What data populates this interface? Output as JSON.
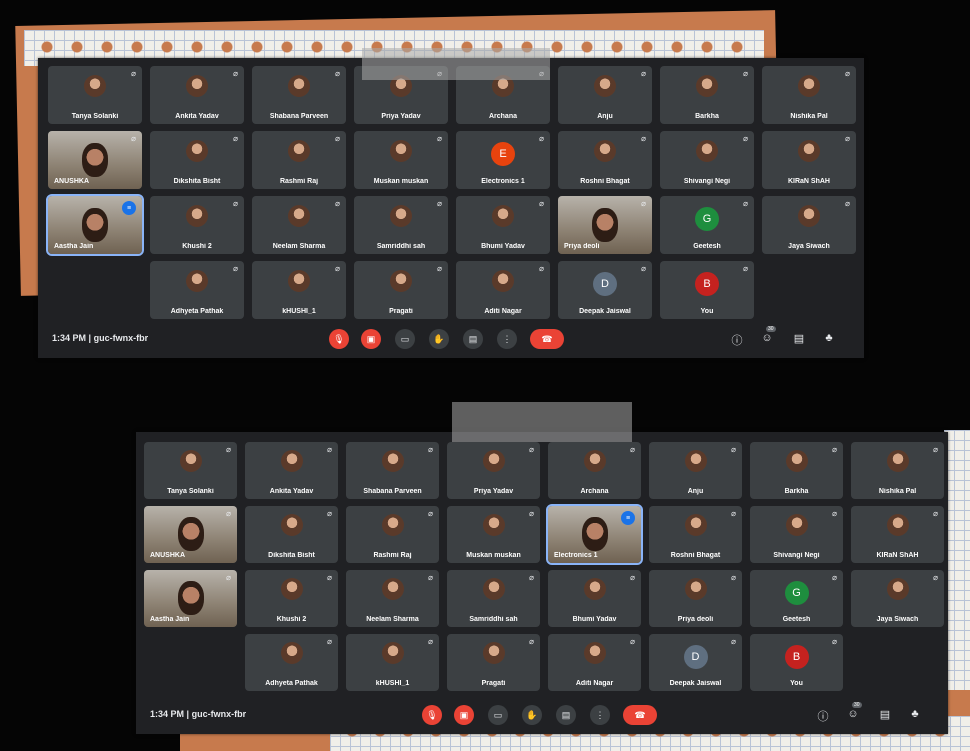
{
  "colors": {
    "meet_bg": "#202124",
    "tile_bg": "#3c4043",
    "danger": "#ea4335",
    "accent": "#1a73e8"
  },
  "windows": [
    {
      "time": "1:34 PM",
      "separator": "|",
      "code": "guc-fwnx-fbr",
      "people_count": "30",
      "tiles": [
        {
          "name": "Tanya Solanki",
          "kind": "photo"
        },
        {
          "name": "Ankita Yadav",
          "kind": "photo"
        },
        {
          "name": "Shabana Parveen",
          "kind": "photo"
        },
        {
          "name": "Priya Yadav",
          "kind": "photo"
        },
        {
          "name": "Archana",
          "kind": "photo"
        },
        {
          "name": "Anju",
          "kind": "photo"
        },
        {
          "name": "Barkha",
          "kind": "photo"
        },
        {
          "name": "Nishika Pal",
          "kind": "photo"
        },
        {
          "name": "ANUSHKA",
          "kind": "video"
        },
        {
          "name": "Dikshita Bisht",
          "kind": "photo"
        },
        {
          "name": "Rashmi Raj",
          "kind": "photo"
        },
        {
          "name": "Muskan muskan",
          "kind": "photo"
        },
        {
          "name": "Electronics 1",
          "kind": "letter",
          "letter": "E",
          "color": "#e8430e"
        },
        {
          "name": "Roshni Bhagat",
          "kind": "photo"
        },
        {
          "name": "Shivangi Negi",
          "kind": "photo"
        },
        {
          "name": "KIRaN ShAH",
          "kind": "photo"
        },
        {
          "name": "Aastha Jain",
          "kind": "video",
          "active": true
        },
        {
          "name": "Khushi 2",
          "kind": "photo"
        },
        {
          "name": "Neelam Sharma",
          "kind": "photo"
        },
        {
          "name": "Samriddhi sah",
          "kind": "photo"
        },
        {
          "name": "Bhumi Yadav",
          "kind": "photo"
        },
        {
          "name": "Priya deoli",
          "kind": "video"
        },
        {
          "name": "Geetesh",
          "kind": "letter",
          "letter": "G",
          "color": "#1e8e3e"
        },
        {
          "name": "Jaya Siwach",
          "kind": "photo"
        },
        {
          "name": "Adhyeta Pathak",
          "kind": "photo"
        },
        {
          "name": "kHUSHI_1",
          "kind": "photo"
        },
        {
          "name": "Pragati",
          "kind": "photo"
        },
        {
          "name": "Aditi Nagar",
          "kind": "photo"
        },
        {
          "name": "Deepak Jaiswal",
          "kind": "letter",
          "letter": "D",
          "color": "#5f6f80"
        },
        {
          "name": "You",
          "kind": "letter",
          "letter": "B",
          "color": "#c5221f"
        }
      ]
    },
    {
      "time": "1:34 PM",
      "separator": "|",
      "code": "guc-fwnx-fbr",
      "people_count": "30",
      "tiles": [
        {
          "name": "Tanya Solanki",
          "kind": "photo"
        },
        {
          "name": "Ankita Yadav",
          "kind": "photo"
        },
        {
          "name": "Shabana Parveen",
          "kind": "photo"
        },
        {
          "name": "Priya Yadav",
          "kind": "photo"
        },
        {
          "name": "Archana",
          "kind": "photo"
        },
        {
          "name": "Anju",
          "kind": "photo"
        },
        {
          "name": "Barkha",
          "kind": "photo"
        },
        {
          "name": "Nishika Pal",
          "kind": "photo"
        },
        {
          "name": "ANUSHKA",
          "kind": "video"
        },
        {
          "name": "Dikshita Bisht",
          "kind": "photo"
        },
        {
          "name": "Rashmi Raj",
          "kind": "photo"
        },
        {
          "name": "Muskan muskan",
          "kind": "photo"
        },
        {
          "name": "Electronics 1",
          "kind": "video",
          "active": true
        },
        {
          "name": "Roshni Bhagat",
          "kind": "photo"
        },
        {
          "name": "Shivangi Negi",
          "kind": "photo"
        },
        {
          "name": "KIRaN ShAH",
          "kind": "photo"
        },
        {
          "name": "Aastha Jain",
          "kind": "video"
        },
        {
          "name": "Khushi 2",
          "kind": "photo"
        },
        {
          "name": "Neelam Sharma",
          "kind": "photo"
        },
        {
          "name": "Samriddhi sah",
          "kind": "photo"
        },
        {
          "name": "Bhumi Yadav",
          "kind": "photo"
        },
        {
          "name": "Priya deoli",
          "kind": "photo"
        },
        {
          "name": "Geetesh",
          "kind": "letter",
          "letter": "G",
          "color": "#1e8e3e"
        },
        {
          "name": "Jaya Siwach",
          "kind": "photo"
        },
        {
          "name": "Adhyeta Pathak",
          "kind": "photo"
        },
        {
          "name": "kHUSHI_1",
          "kind": "photo"
        },
        {
          "name": "Pragati",
          "kind": "photo"
        },
        {
          "name": "Aditi Nagar",
          "kind": "photo"
        },
        {
          "name": "Deepak Jaiswal",
          "kind": "letter",
          "letter": "D",
          "color": "#5f6f80"
        },
        {
          "name": "You",
          "kind": "letter",
          "letter": "B",
          "color": "#c5221f"
        }
      ]
    }
  ],
  "icons": {
    "mic": "mic-off-icon",
    "camera": "camera-off-icon",
    "captions": "captions-icon",
    "hand": "raise-hand-icon",
    "present": "present-screen-icon",
    "more": "more-options-icon",
    "hangup": "hang-up-icon",
    "info": "info-icon",
    "people": "people-icon",
    "chat": "chat-icon",
    "activities": "activities-icon"
  }
}
